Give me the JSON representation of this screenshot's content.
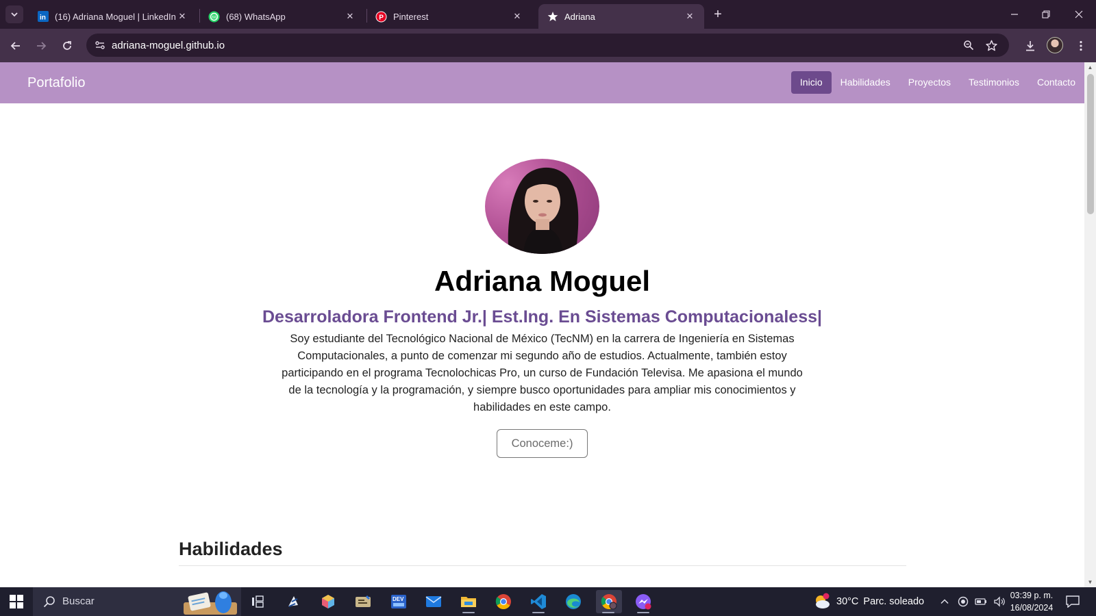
{
  "browser": {
    "tabs": [
      {
        "title": "(16) Adriana Moguel | LinkedIn",
        "icon": "linkedin-icon",
        "active": false
      },
      {
        "title": "(68) WhatsApp",
        "icon": "whatsapp-icon",
        "active": false
      },
      {
        "title": "Pinterest",
        "icon": "pinterest-icon",
        "active": false
      },
      {
        "title": "Adriana",
        "icon": "star-favicon-icon",
        "active": true
      }
    ],
    "url": "adriana-moguel.github.io",
    "colors": {
      "frame": "#2a1b2f",
      "toolbar": "#44314a"
    }
  },
  "site": {
    "brand": "Portafolio",
    "nav": [
      {
        "label": "Inicio",
        "active": true
      },
      {
        "label": "Habilidades",
        "active": false
      },
      {
        "label": "Proyectos",
        "active": false
      },
      {
        "label": "Testimonios",
        "active": false
      },
      {
        "label": "Contacto",
        "active": false
      }
    ],
    "hero": {
      "name": "Adriana Moguel",
      "subtitle": "Desarroladora Frontend Jr.| Est.Ing. En Sistemas Computacionaless|",
      "bio": "Soy estudiante del Tecnológico Nacional de México (TecNM) en la carrera de Ingeniería en Sistemas Computacionales, a punto de comenzar mi segundo año de estudios. Actualmente, también estoy participando en el programa Tecnolochicas Pro, un curso de Fundación Televisa. Me apasiona el mundo de la tecnología y la programación, y siempre busco oportunidades para ampliar mis conocimientos y habilidades en este campo.",
      "cta": "Conoceme:)"
    },
    "skills_section_title": "Habilidades",
    "colors": {
      "navbar": "#b691c5",
      "nav_active": "#6d4a8c",
      "subtitle": "#6a4c92"
    }
  },
  "taskbar": {
    "search_placeholder": "Buscar",
    "weather": {
      "temp": "30°C",
      "condition": "Parc. soleado",
      "alert_count": "1"
    },
    "time": "03:39 p. m.",
    "date": "16/08/2024",
    "apps": [
      "task-view-icon",
      "inkscape-icon",
      "cube-app-icon",
      "code-editor-icon",
      "dev-home-icon",
      "mail-icon",
      "file-explorer-icon",
      "chrome-icon",
      "vscode-icon",
      "edge-icon",
      "chrome-profile-icon",
      "messenger-icon"
    ]
  }
}
